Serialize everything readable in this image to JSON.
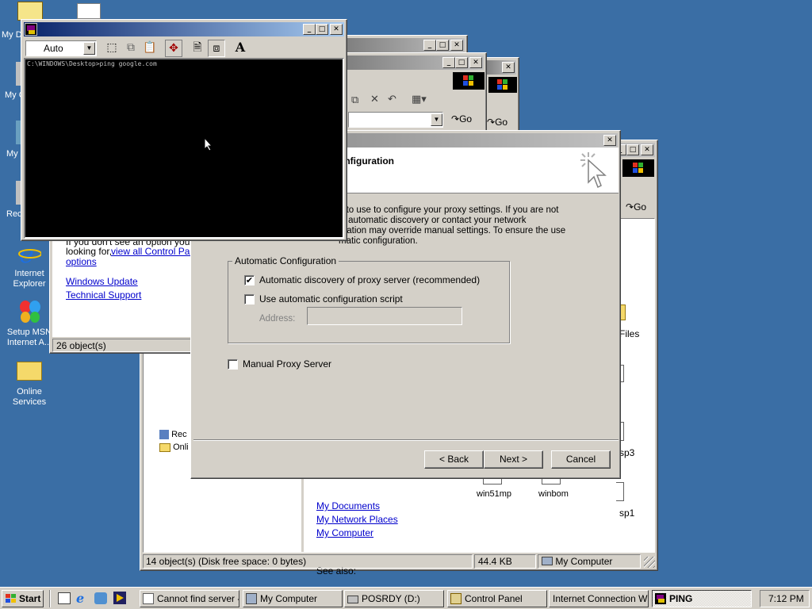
{
  "desktop": {
    "icons": [
      {
        "label": "My D",
        "icon": "my-documents-icon"
      },
      {
        "label": "My C",
        "icon": "my-computer-icon"
      },
      {
        "label": "My N",
        "icon": "my-network-places-icon"
      },
      {
        "label": "Rec",
        "icon": "recycle-bin-icon"
      },
      {
        "label": "Internet Explorer",
        "icon": "internet-explorer-icon"
      },
      {
        "label": "Setup MSN Internet A...",
        "icon": "msn-butterfly-icon"
      },
      {
        "label": "Online Services",
        "icon": "folder-icon"
      }
    ]
  },
  "cmd_window": {
    "font_select": "Auto",
    "command_line": "C:\\WINDOWS\\Desktop>ping google.com",
    "title": ""
  },
  "back_window1": {
    "go_label": "Go"
  },
  "back_window2": {
    "go_label": "Go"
  },
  "control_panel": {
    "text_line1": "If you don't see an option you're",
    "text_line2": "looking for,",
    "link_view_all": "view all Control Panel",
    "link_options": "options",
    "link_windows_update": "Windows Update",
    "link_technical_support": "Technical Support",
    "status": "26 object(s)"
  },
  "my_computer": {
    "tree_items": [
      "Rec",
      "Onli"
    ],
    "see_also_label": "See also:",
    "links": [
      "My Documents",
      "My Network Places",
      "My Computer"
    ],
    "file_labels": [
      "Files",
      "sp3",
      "sp1",
      "win51mp",
      "winbom"
    ],
    "status_objects": "14 object(s) (Disk free space: 0 bytes)",
    "status_size": "44.4 KB",
    "status_location": "My Computer",
    "go_label": "Go"
  },
  "wizard": {
    "heading": "onfiguration",
    "intro_lines": [
      "e to use to configure your proxy settings.  If you are not",
      "ct automatic discovery or contact your network",
      "uration may override manual settings.  To ensure the use",
      "matic configuration."
    ],
    "group_label": "Automatic Configuration",
    "option_auto_discovery": "Automatic discovery of proxy server (recommended)",
    "option_auto_discovery_checked": "✔",
    "option_script": "Use automatic configuration script",
    "address_label": "Address:",
    "address_value": "",
    "option_manual": "Manual Proxy Server",
    "back_label": "< Back",
    "next_label": "Next >",
    "cancel_label": "Cancel"
  },
  "taskbar": {
    "start_label": "Start",
    "tasks": [
      {
        "label": "Cannot find server -...",
        "icon": "ie-page-icon"
      },
      {
        "label": "My Computer",
        "icon": "my-computer-icon"
      },
      {
        "label": "POSRDY (D:)",
        "icon": "drive-icon"
      },
      {
        "label": "Control Panel",
        "icon": "control-panel-icon"
      },
      {
        "label": "Internet Connection Wi...",
        "icon": ""
      },
      {
        "label": "PING",
        "icon": "msdos-icon"
      }
    ],
    "clock": "7:12 PM"
  }
}
